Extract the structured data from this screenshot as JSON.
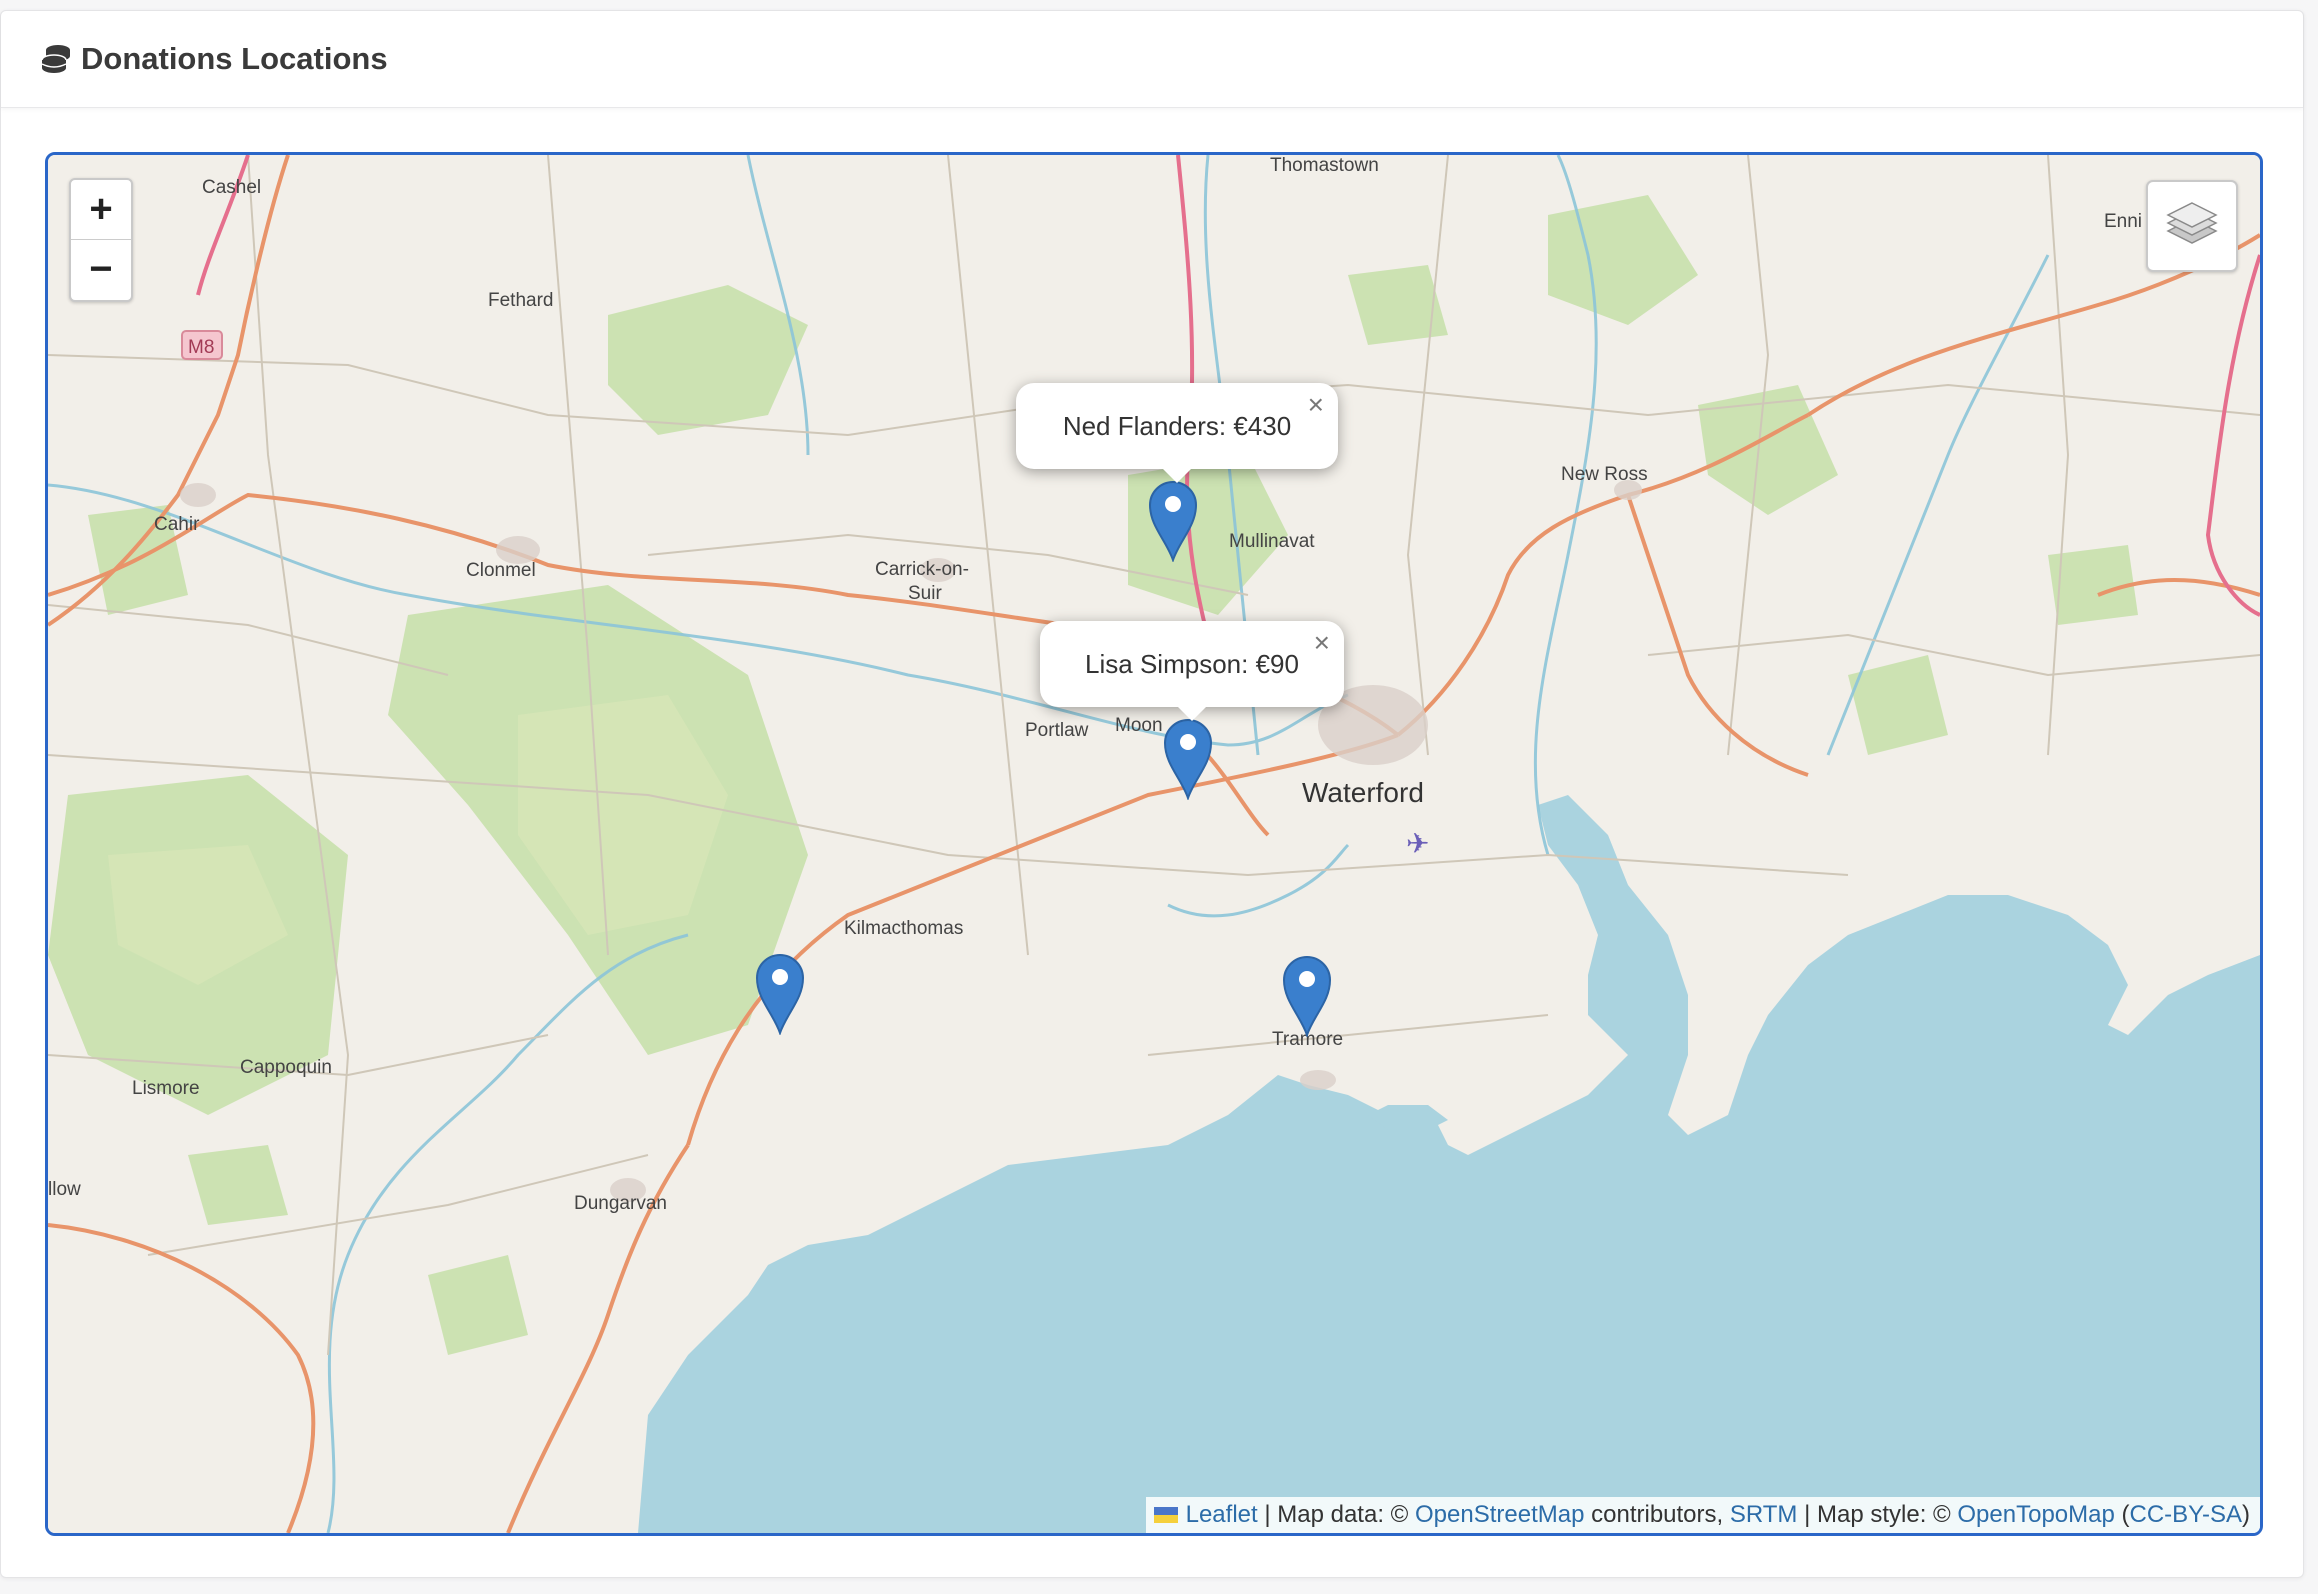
{
  "header": {
    "title": "Donations Locations",
    "icon": "coins-icon"
  },
  "zoom_controls": {
    "zoom_in": "+",
    "zoom_out": "−"
  },
  "layers_control": {
    "icon": "layers-icon"
  },
  "places": {
    "cashel": "Cashel",
    "fethard": "Fethard",
    "cahir": "Cahir",
    "clonmel": "Clonmel",
    "carrick_1": "Carrick-on-",
    "carrick_2": "Suir",
    "thomastown": "Thomastown",
    "mullinavat": "Mullinavat",
    "new_ross": "New Ross",
    "enni": "Enni",
    "portlaw": "Portlaw",
    "moon": "Moon",
    "waterford": "Waterford",
    "kilmacthomas": "Kilmacthomas",
    "cappoquin": "Cappoquin",
    "lismore": "Lismore",
    "llow": "llow",
    "dungarvan": "Dungarvan",
    "tramore": "Tramore",
    "m8": "M8"
  },
  "popups": [
    {
      "text": "Ned Flanders: €430",
      "close": "×"
    },
    {
      "text": "Lisa Simpson: €90",
      "close": "×"
    }
  ],
  "attribution": {
    "leaflet": "Leaflet",
    "sep1": "| Map data: ©",
    "osm": "OpenStreetMap",
    "contributors": "contributors,",
    "srtm": "SRTM",
    "sep2": "| Map style: ©",
    "opentopo": "OpenTopoMap",
    "paren_open": "(",
    "license": "CC-BY-SA",
    "paren_close": ")"
  },
  "colors": {
    "map_border": "#2a66c8",
    "marker": "#3a7fcd",
    "sea": "#aad3df",
    "land": "#f2efe9",
    "forest": "#c6dfa8",
    "major_road": "#e8946a",
    "river": "#8cc4d8"
  }
}
